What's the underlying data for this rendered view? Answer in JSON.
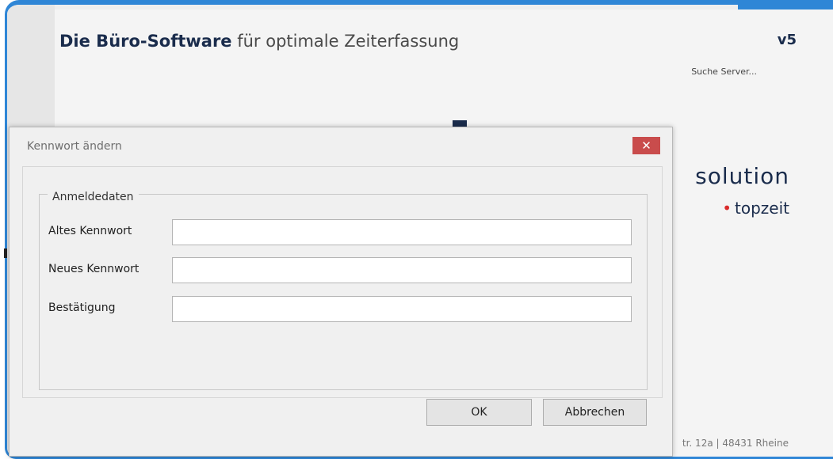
{
  "splash": {
    "headline_brand": "Die Büro-Software",
    "headline_rest": " für optimale Zeiterfassung",
    "version": "v5",
    "status": "Suche Server...",
    "logo_text": "solution",
    "logo_sub": "topzeit",
    "address": "tr. 12a | 48431 Rheine"
  },
  "dialog": {
    "title": "Kennwort ändern",
    "close_icon": "close-icon",
    "group_title": "Anmeldedaten",
    "fields": [
      {
        "label": "Altes Kennwort",
        "value": ""
      },
      {
        "label": "Neues Kennwort",
        "value": ""
      },
      {
        "label": "Bestätigung",
        "value": ""
      }
    ],
    "ok_label": "OK",
    "cancel_label": "Abbrechen"
  },
  "colors": {
    "accent": "#2f86d6",
    "brand": "#1a2c4c",
    "close": "#c94c4c"
  }
}
